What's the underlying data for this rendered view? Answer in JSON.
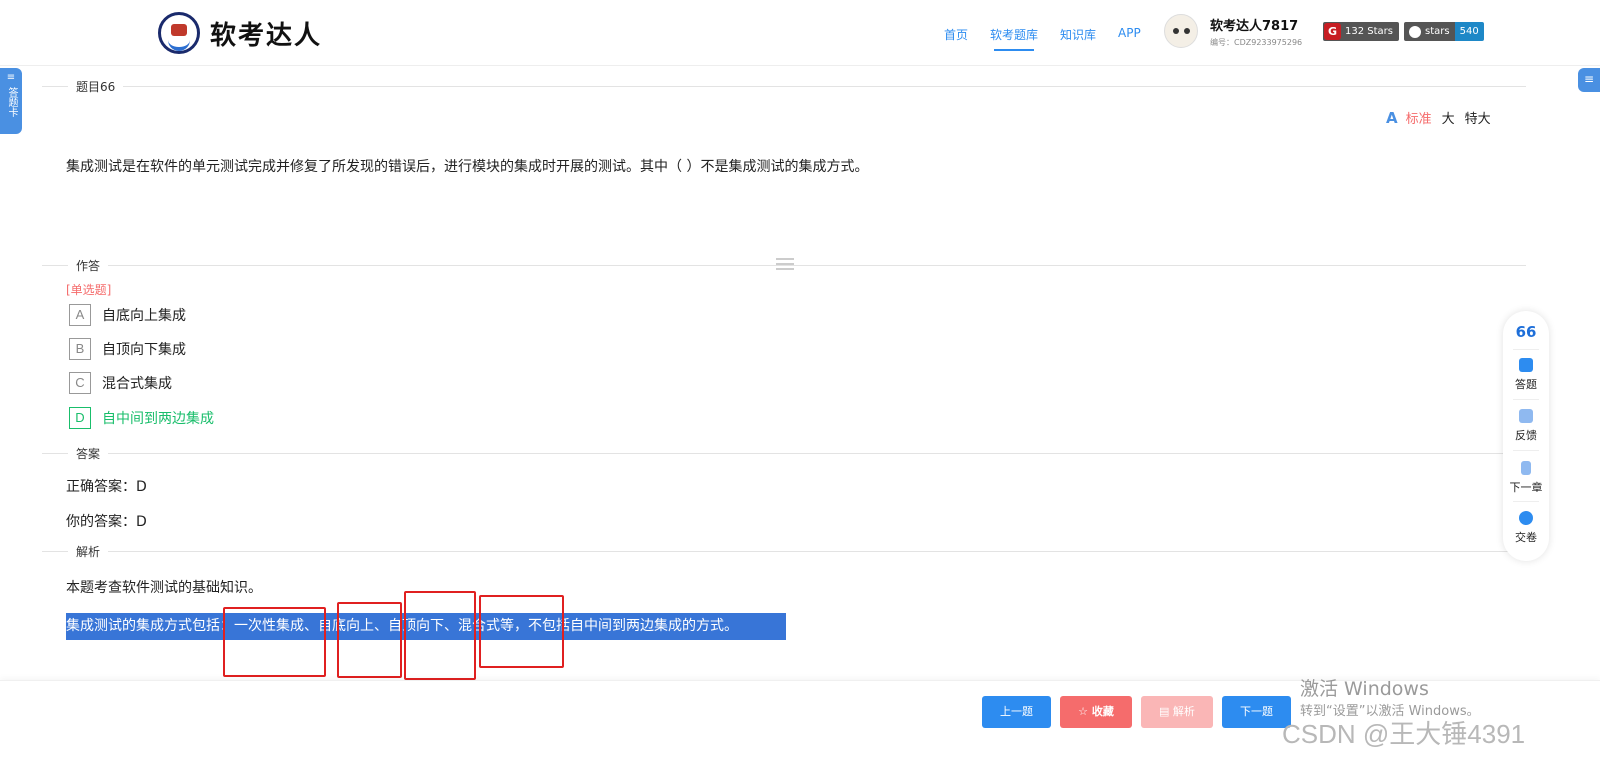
{
  "header": {
    "logo_text": "软考达人",
    "nav": [
      {
        "label": "首页",
        "active": false
      },
      {
        "label": "软考题库",
        "active": true
      },
      {
        "label": "知识库",
        "active": false
      },
      {
        "label": "APP",
        "active": false
      }
    ],
    "user": {
      "name": "软考达人7817",
      "id": "编号：CDZ9233975296"
    },
    "badges": {
      "gitee_icon": "G",
      "gitee_text": "132 Stars",
      "github_left": "stars",
      "github_right": "540"
    }
  },
  "side": {
    "card_tab": "答题卡",
    "right_tab_icon": "≡",
    "card_tab_icon": "≡"
  },
  "sections": {
    "question_title": "题目66",
    "answer_title": "作答",
    "key_title": "答案",
    "analysis_title": "解析"
  },
  "font_size": {
    "icon": "A",
    "options": [
      "标准",
      "大",
      "特大"
    ],
    "active": "标准"
  },
  "question": {
    "text": "集成测试是在软件的单元测试完成并修复了所发现的错误后，进行模块的集成时开展的测试。其中（ ）不是集成测试的集成方式。",
    "type": "[单选题]",
    "options": [
      {
        "letter": "A",
        "text": "自底向上集成"
      },
      {
        "letter": "B",
        "text": "自顶向下集成"
      },
      {
        "letter": "C",
        "text": "混合式集成"
      },
      {
        "letter": "D",
        "text": "自中间到两边集成"
      }
    ]
  },
  "answer": {
    "correct": "正确答案：D",
    "yours": "你的答案：D"
  },
  "analysis": {
    "line1": "本题考查软件测试的基础知识。",
    "line2": "集成测试的集成方式包括：一次性集成、自底向上、自顶向下、混合式等，不包括自中间到两边集成的方式。"
  },
  "float_panel": {
    "number": "66",
    "items": [
      "答题",
      "反馈",
      "下一章",
      "交卷"
    ]
  },
  "buttons": {
    "prev": "上一题",
    "fav": "☆ 收藏",
    "explain": "▤ 解析",
    "next": "下一题"
  },
  "watermark": {
    "line1": "激活 Windows",
    "line2": "转到“设置”以激活 Windows。",
    "csdn": "CSDN @王大锤4391"
  },
  "colors": {
    "accent": "#2d8cf0",
    "correct": "#19be6b",
    "danger": "#f56c6c",
    "highlight": "#3875d7"
  }
}
